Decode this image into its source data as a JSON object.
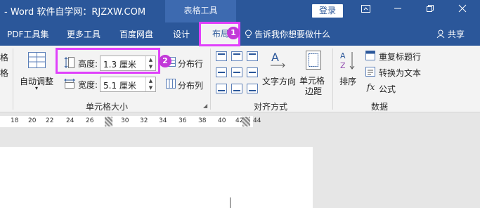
{
  "title_bar": {
    "app_title": "- Word   软件自学网：RJZXW.COM",
    "context_tab_group": "表格工具",
    "login_label": "登录"
  },
  "tabs": {
    "pdf": "PDF工具集",
    "more_tools": "更多工具",
    "baidu": "百度网盘",
    "design": "设计",
    "layout": "布局",
    "tell_me": "告诉我你想要做什么",
    "share": "共享"
  },
  "ribbon": {
    "left_partial": [
      "格",
      "格"
    ],
    "autofit": "自动调整",
    "height_label": "高度:",
    "height_value": "1.3 厘米",
    "width_label": "宽度:",
    "width_value": "5.1 厘米",
    "distribute_rows": "分布行",
    "distribute_cols": "分布列",
    "cell_size_group": "单元格大小",
    "text_direction": "文字方向",
    "cell_margins_line1": "单元格",
    "cell_margins_line2": "边距",
    "alignment_group": "对齐方式",
    "sort": "排序",
    "repeat_header": "重复标题行",
    "convert_to_text": "转换为文本",
    "formula": "公式",
    "data_group": "数据"
  },
  "ruler": {
    "ticks": [
      "18",
      "20",
      "22",
      "24",
      "26",
      "28",
      "30",
      "32",
      "34",
      "36",
      "38",
      "40",
      "42",
      "44"
    ]
  },
  "annotations": {
    "badge_1": "1",
    "badge_2": "2"
  },
  "colors": {
    "brand_blue": "#2b579a",
    "callout": "#e040fb"
  }
}
